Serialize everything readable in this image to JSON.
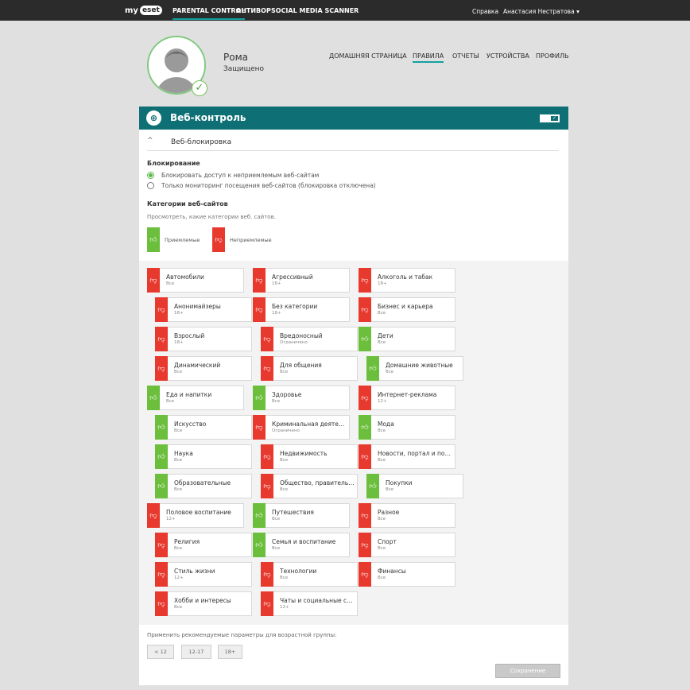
{
  "topbar": {
    "logo_my": "my",
    "logo_brand": "eset",
    "nav": [
      "PARENTAL CONTROL",
      "АНТИВОР",
      "SOCIAL MEDIA SCANNER"
    ],
    "help": "Справка",
    "user": "Анастасия Нестратова ▾"
  },
  "child": {
    "name": "Рома",
    "status": "Защищено"
  },
  "subnav": [
    "ДОМАШНЯЯ СТРАНИЦА",
    "ПРАВИЛА",
    "ОТЧЕТЫ",
    "УСТРОЙСТВА",
    "ПРОФИЛЬ"
  ],
  "panel": {
    "title": "Веб-контроль",
    "section_title": "Веб-блокировка",
    "blocking_label": "Блокирование",
    "radio_block": "Блокировать доступ к неприемлемым веб-сайтам",
    "radio_monitor": "Только мониторинг посещения веб-сайтов (блокировка отключена)",
    "categories_label": "Категории веб-сайтов",
    "categories_hint": "Просмотреть, какие категории веб. сайтов.",
    "legend_allowed": "Приемлемые",
    "legend_blocked": "Неприемлемые",
    "apply_hint": "Применить рекомендуемые параметры для возрастной группы:",
    "age_buttons": [
      "< 12",
      "12-17",
      "18+"
    ],
    "save": "Сохранение"
  },
  "colors": {
    "accent": "#0e7075",
    "allowed": "#6bbf3c",
    "blocked": "#e8392f"
  },
  "categories": [
    {
      "name": "Автомобили",
      "sub": "Все",
      "status": "blocked"
    },
    {
      "name": "Агрессивный",
      "sub": "18+",
      "status": "blocked"
    },
    {
      "name": "Алкоголь и табак",
      "sub": "18+",
      "status": "blocked"
    },
    {
      "name": "Анонимайзеры",
      "sub": "18+",
      "status": "blocked"
    },
    {
      "name": "Без категории",
      "sub": "18+",
      "status": "blocked"
    },
    {
      "name": "Бизнес и карьера",
      "sub": "Все",
      "status": "blocked"
    },
    {
      "name": "Взрослый",
      "sub": "18+",
      "status": "blocked"
    },
    {
      "name": "Вредоносный",
      "sub": "Ограничено",
      "status": "blocked"
    },
    {
      "name": "Дети",
      "sub": "Все",
      "status": "allowed"
    },
    {
      "name": "Динамический",
      "sub": "Все",
      "status": "blocked"
    },
    {
      "name": "Для общения",
      "sub": "Все",
      "status": "blocked"
    },
    {
      "name": "Домашние животные",
      "sub": "Все",
      "status": "allowed"
    },
    {
      "name": "Еда и напитки",
      "sub": "Все",
      "status": "allowed"
    },
    {
      "name": "Здоровье",
      "sub": "Все",
      "status": "allowed"
    },
    {
      "name": "Интернет-реклама",
      "sub": "12+",
      "status": "blocked"
    },
    {
      "name": "Искусство",
      "sub": "Все",
      "status": "allowed"
    },
    {
      "name": "Криминальная деятельн...",
      "sub": "Ограничено",
      "status": "blocked"
    },
    {
      "name": "Мода",
      "sub": "Все",
      "status": "allowed"
    },
    {
      "name": "Наука",
      "sub": "Все",
      "status": "allowed"
    },
    {
      "name": "Недвижимость",
      "sub": "Все",
      "status": "blocked"
    },
    {
      "name": "Новости, портал и поиск",
      "sub": "Все",
      "status": "blocked"
    },
    {
      "name": "Образовательные",
      "sub": "Все",
      "status": "allowed"
    },
    {
      "name": "Общество, правительст...",
      "sub": "Все",
      "status": "blocked"
    },
    {
      "name": "Покупки",
      "sub": "Все",
      "status": "allowed"
    },
    {
      "name": "Половое воспитание",
      "sub": "12+",
      "status": "blocked"
    },
    {
      "name": "Путешествия",
      "sub": "Все",
      "status": "allowed"
    },
    {
      "name": "Разное",
      "sub": "Все",
      "status": "blocked"
    },
    {
      "name": "Религия",
      "sub": "Все",
      "status": "blocked"
    },
    {
      "name": "Семья и воспитание",
      "sub": "Все",
      "status": "allowed"
    },
    {
      "name": "Спорт",
      "sub": "Все",
      "status": "blocked"
    },
    {
      "name": "Стиль жизни",
      "sub": "12+",
      "status": "blocked"
    },
    {
      "name": "Технологии",
      "sub": "Все",
      "status": "blocked"
    },
    {
      "name": "Финансы",
      "sub": "Все",
      "status": "blocked"
    },
    {
      "name": "Хобби и интересы",
      "sub": "Все",
      "status": "blocked"
    },
    {
      "name": "Чаты и социальные сети",
      "sub": "12+",
      "status": "blocked"
    }
  ]
}
